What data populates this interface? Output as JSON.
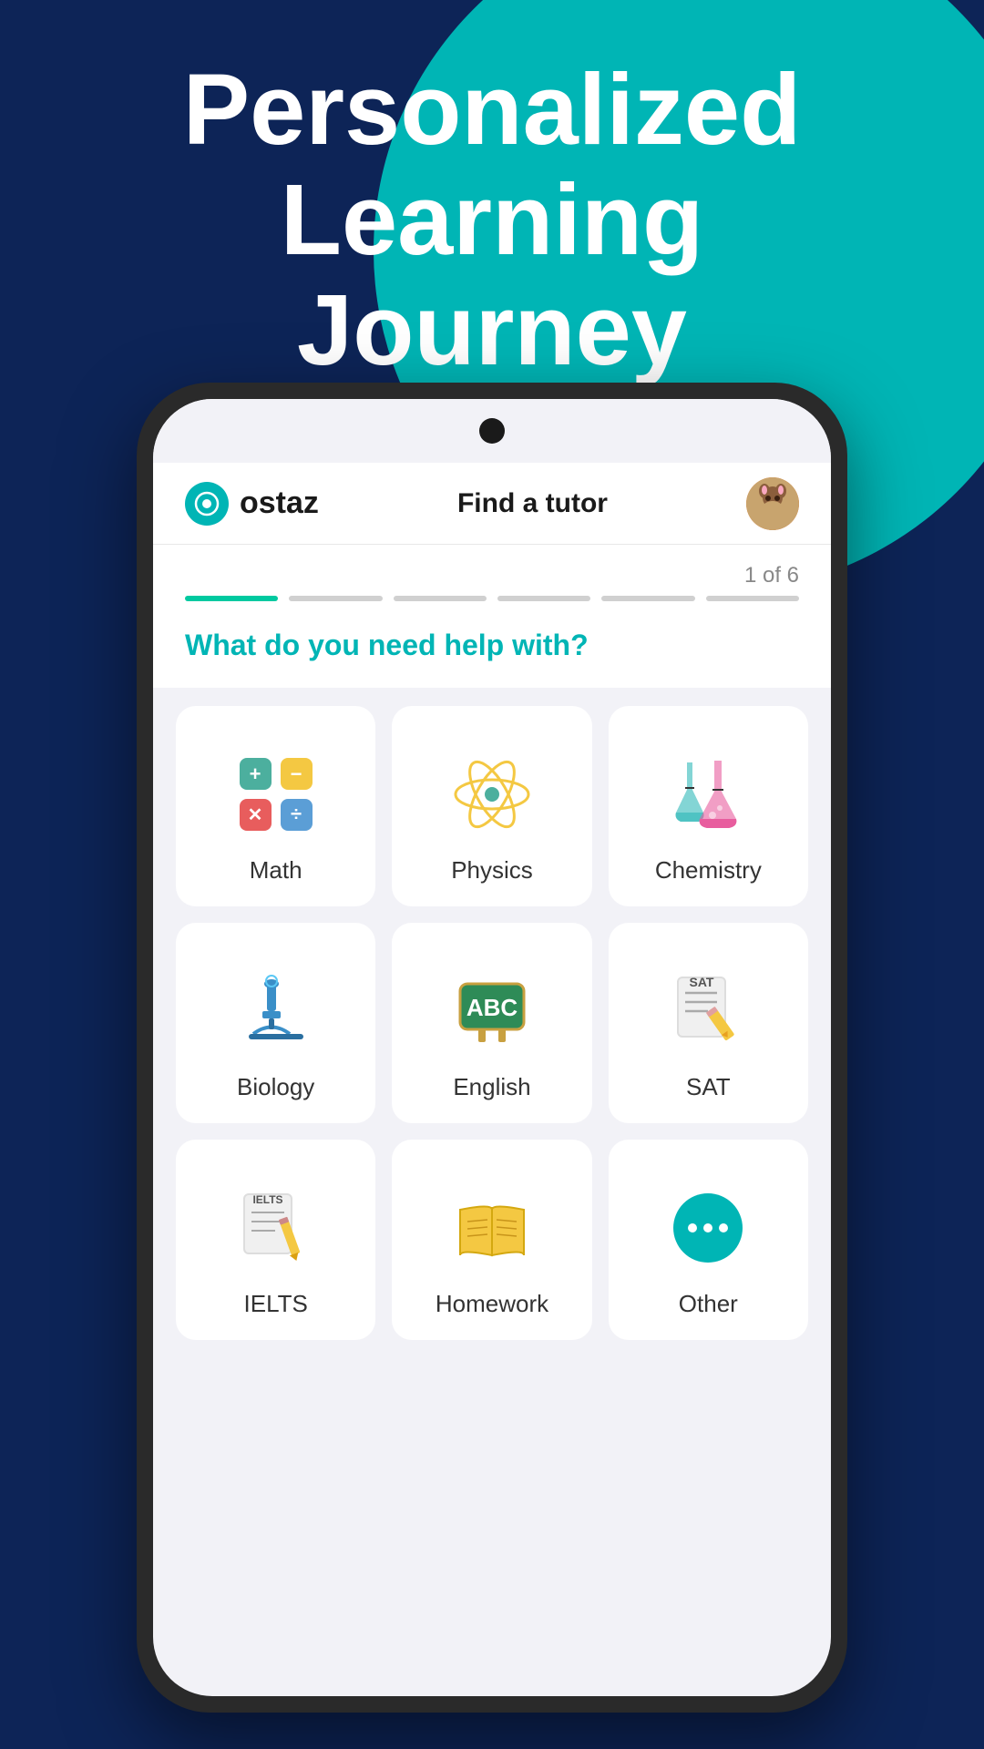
{
  "hero": {
    "title": "Personalized\nLearning\nJourney"
  },
  "header": {
    "logo_icon": "O",
    "logo_text": "ostaz",
    "title": "Find a tutor",
    "avatar_emoji": "🐱"
  },
  "progress": {
    "label": "1 of 6",
    "steps": 6,
    "active_step": 1
  },
  "question": {
    "text": "What do you need help with?"
  },
  "subjects": [
    {
      "id": "math",
      "name": "Math",
      "icon": "math"
    },
    {
      "id": "physics",
      "name": "Physics",
      "icon": "physics"
    },
    {
      "id": "chemistry",
      "name": "Chemistry",
      "icon": "chemistry"
    },
    {
      "id": "biology",
      "name": "Biology",
      "icon": "biology"
    },
    {
      "id": "english",
      "name": "English",
      "icon": "english"
    },
    {
      "id": "sat",
      "name": "SAT",
      "icon": "sat"
    },
    {
      "id": "ielts",
      "name": "IELTS",
      "icon": "ielts"
    },
    {
      "id": "homework",
      "name": "Homework",
      "icon": "homework"
    },
    {
      "id": "other",
      "name": "Other",
      "icon": "other"
    }
  ]
}
